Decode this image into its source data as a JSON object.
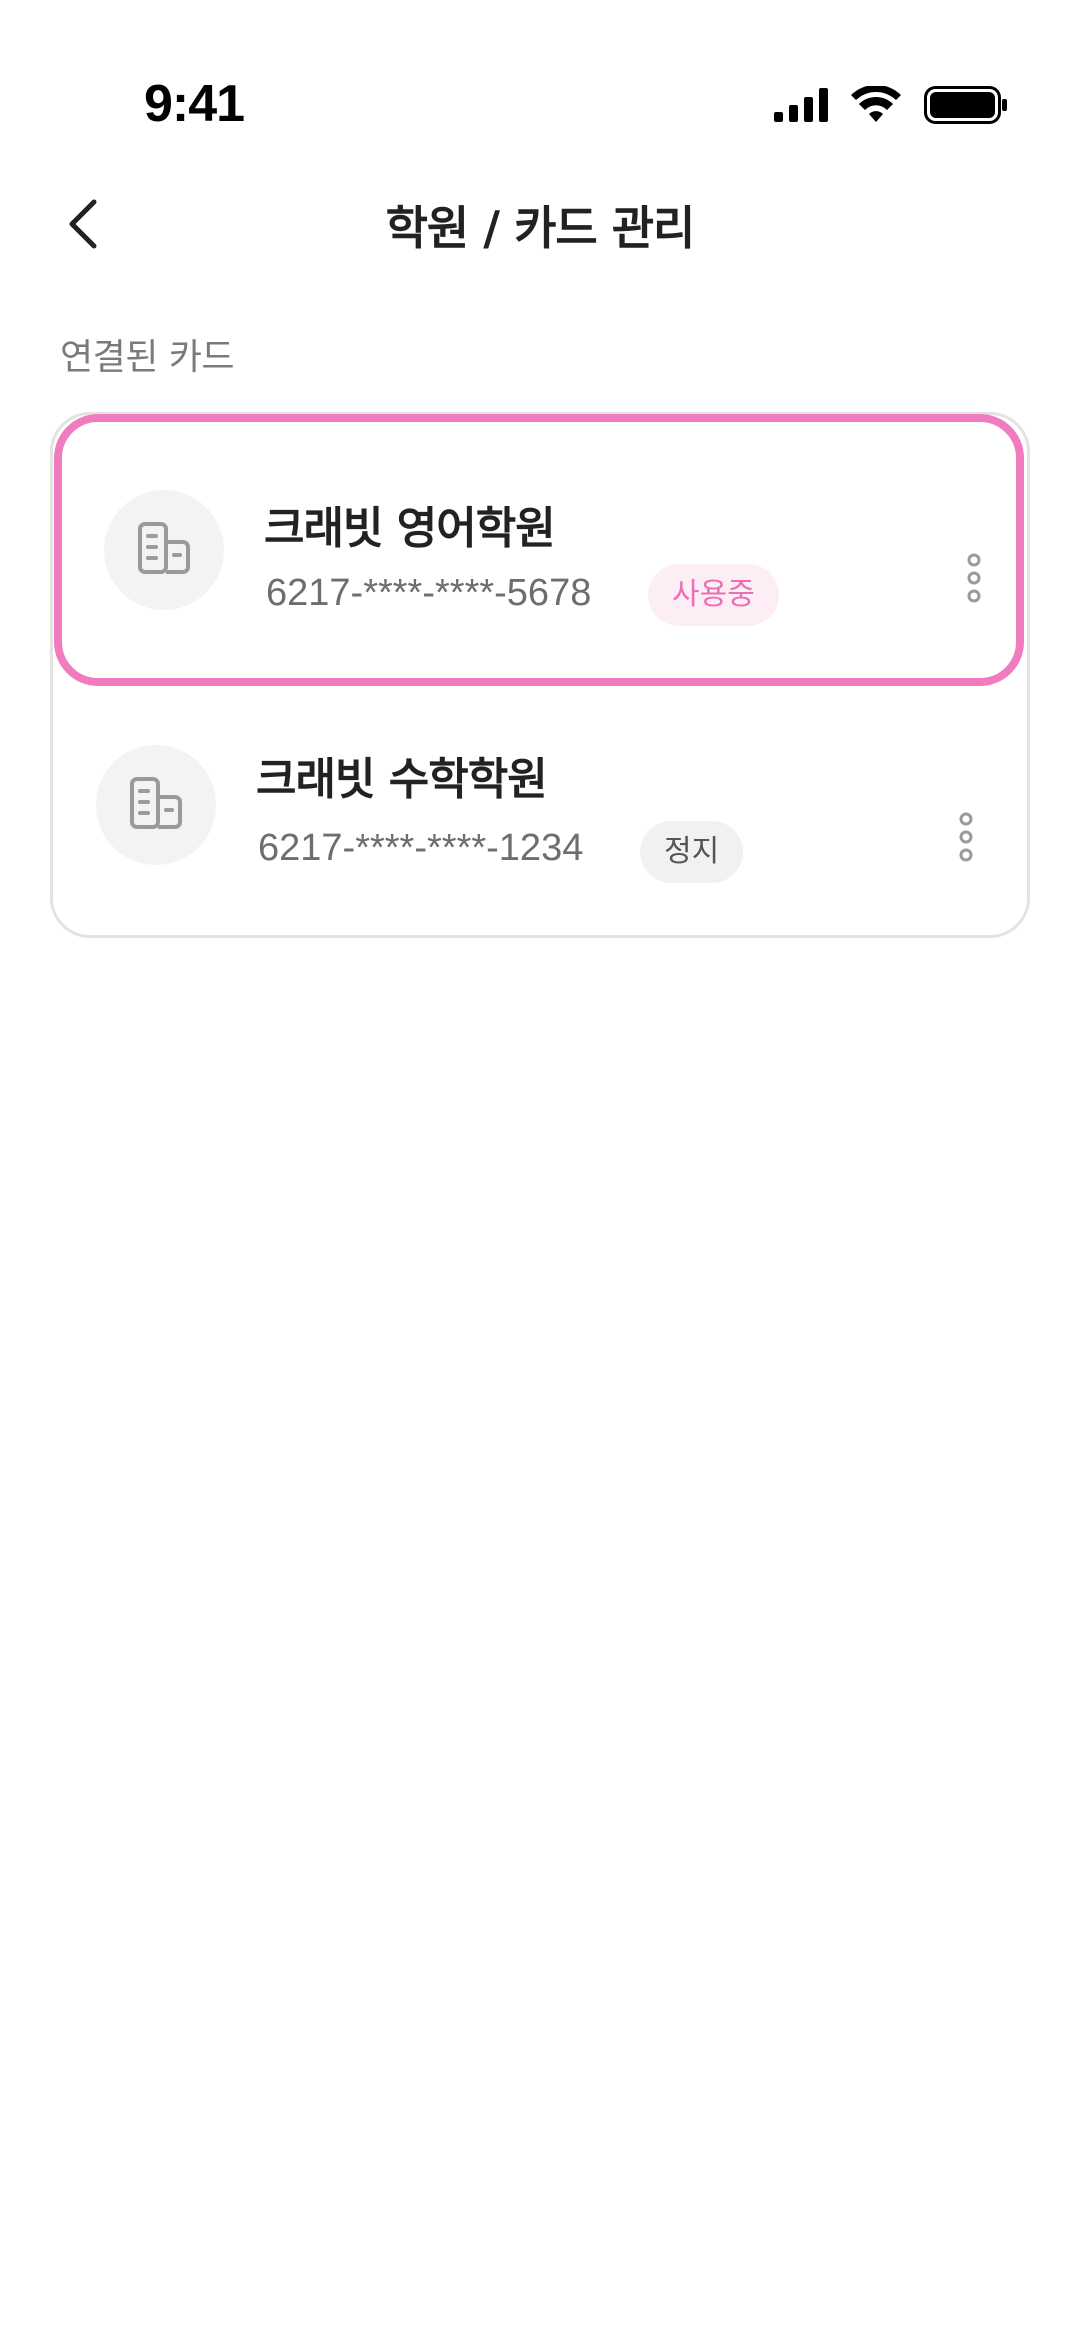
{
  "status_bar": {
    "time": "9:41",
    "icons": [
      "cellular-signal-icon",
      "wifi-icon",
      "battery-icon"
    ]
  },
  "header": {
    "title": "학원 / 카드 관리",
    "back_icon": "chevron-left-icon"
  },
  "section": {
    "label": "연결된 카드"
  },
  "cards": [
    {
      "name": "크래빗 영어학원",
      "number": "6217-****-****-5678",
      "status": "사용중",
      "status_type": "active",
      "selected": true,
      "icon": "building-icon"
    },
    {
      "name": "크래빗 수학학원",
      "number": "6217-****-****-1234",
      "status": "정지",
      "status_type": "stopped",
      "selected": false,
      "icon": "building-icon"
    }
  ],
  "colors": {
    "accent": "#f07cbf",
    "active_badge_bg": "#fdeef5",
    "active_badge_text": "#ea6fb4",
    "stopped_badge_bg": "#f1f1f1"
  }
}
